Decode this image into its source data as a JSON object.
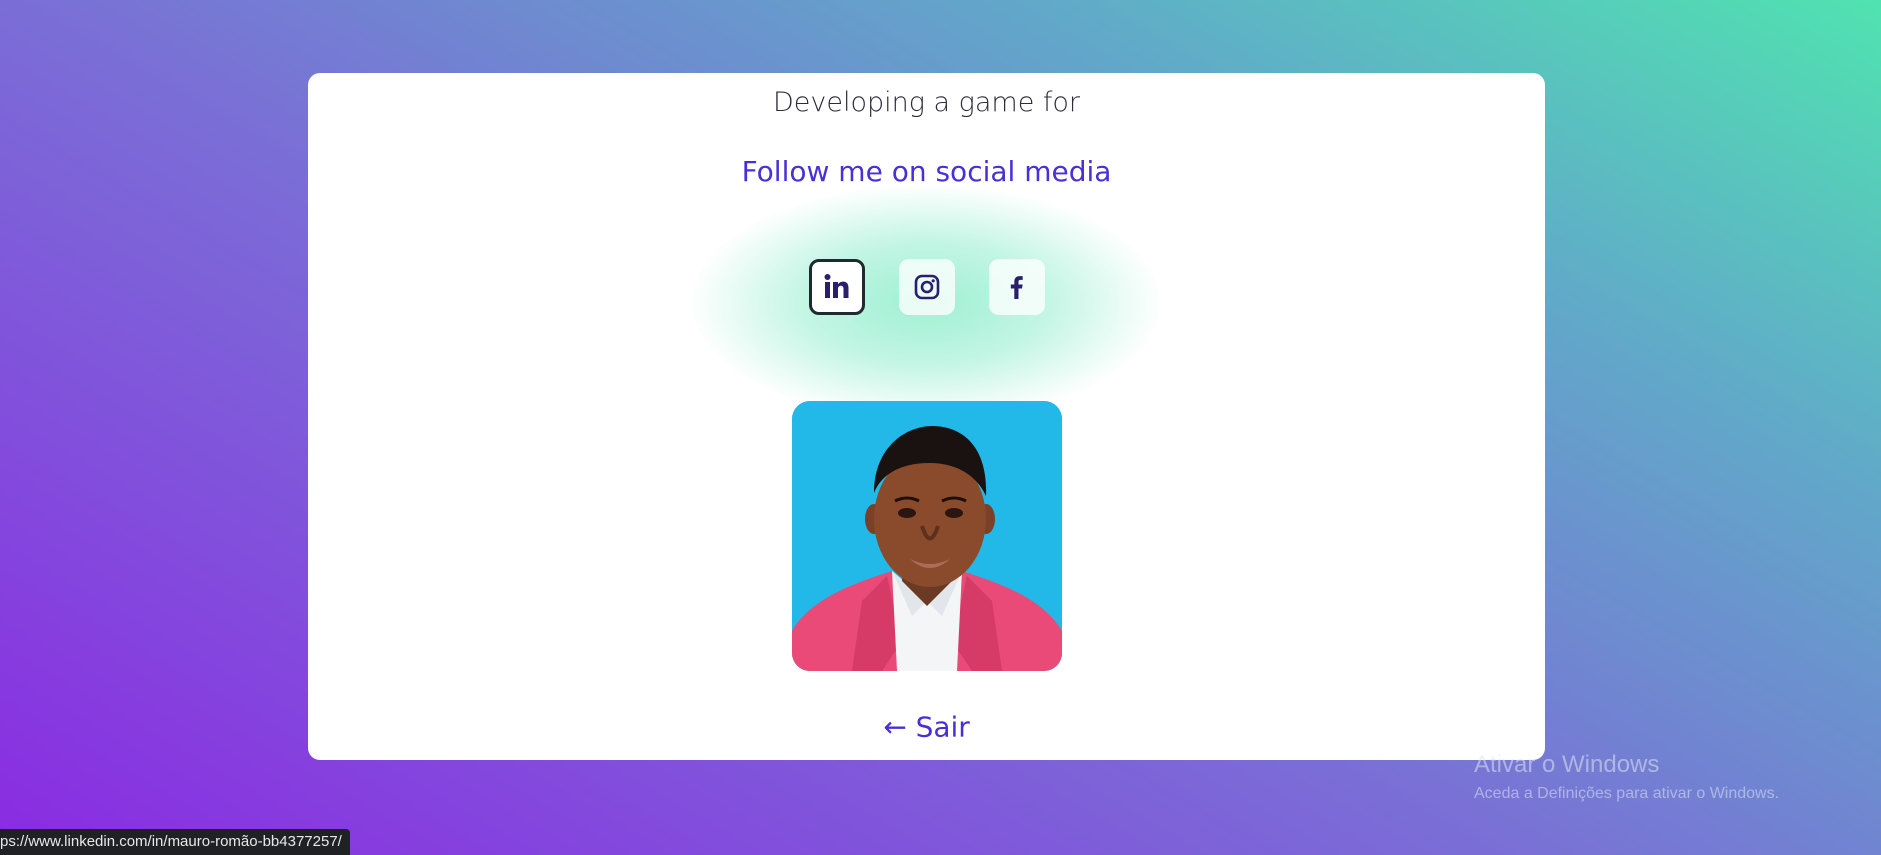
{
  "card": {
    "headline": "Developing a game for",
    "follow_text": "Follow me on social media",
    "socials": [
      {
        "icon": "linkedin-icon",
        "label": "in"
      },
      {
        "icon": "instagram-icon"
      },
      {
        "icon": "facebook-icon",
        "label": "f"
      }
    ],
    "back_arrow": "←",
    "back_label": "Sair"
  },
  "watermark": {
    "title": "Ativar o Windows",
    "subtitle": "Aceda a Definições para ativar o Windows."
  },
  "status_bar": {
    "url": "ps://www.linkedin.com/in/mauro-romão-bb4377257/"
  },
  "colors": {
    "accent": "#4a2fd6",
    "glow": "#50e3b0",
    "icon": "#2a1f6e",
    "photo_background": "#22b8e8",
    "jacket": "#ea4a78"
  }
}
